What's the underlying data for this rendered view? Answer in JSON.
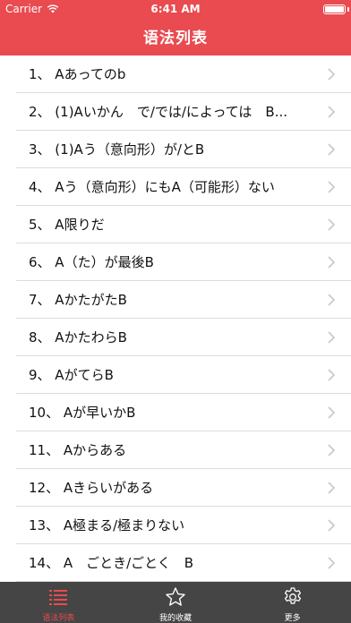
{
  "status_bar": {
    "carrier": "Carrier",
    "time": "6:41 AM"
  },
  "nav": {
    "title": "语法列表"
  },
  "colors": {
    "accent": "#e94b50",
    "tab_bar": "#454545"
  },
  "list": {
    "items": [
      "1、 Aあってのb",
      "2、 (1)Aいかん　で/では/によっては　B...",
      "3、 (1)Aう（意向形）が/とB",
      "4、 Aう（意向形）にもA（可能形）ない",
      "5、 A限りだ",
      "6、 A（た）が最後B",
      "7、 AかたがたB",
      "8、 AかたわらB",
      "9、 AがてらB",
      "10、 Aが早いかB",
      "11、 Aからある",
      "12、 Aきらいがある",
      "13、 A極まる/極まりない",
      "14、 A　ごとき/ごとく　B"
    ]
  },
  "tabs": [
    {
      "label": "语法列表",
      "icon": "list-icon",
      "active": true
    },
    {
      "label": "我的收藏",
      "icon": "star-icon",
      "active": false
    },
    {
      "label": "更多",
      "icon": "gear-icon",
      "active": false
    }
  ]
}
